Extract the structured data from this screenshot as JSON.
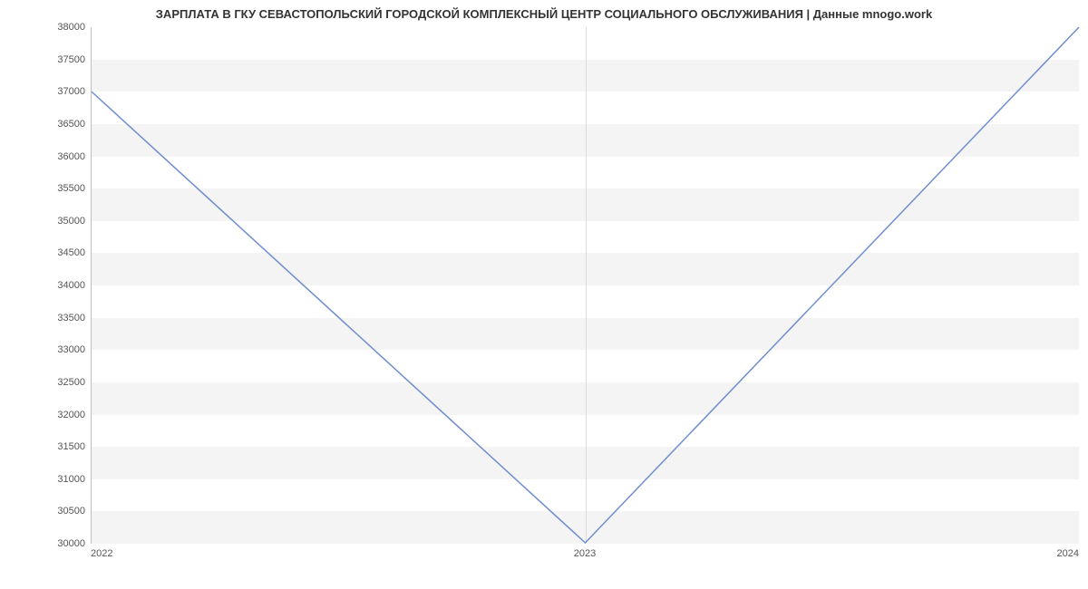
{
  "chart_data": {
    "type": "line",
    "title": "ЗАРПЛАТА В ГКУ СЕВАСТОПОЛЬСКИЙ ГОРОДСКОЙ КОМПЛЕКСНЫЙ ЦЕНТР СОЦИАЛЬНОГО ОБСЛУЖИВАНИЯ | Данные mnogo.work",
    "x": [
      2022,
      2023,
      2024
    ],
    "values": [
      37000,
      30000,
      38000
    ],
    "x_ticks": [
      "2022",
      "2023",
      "2024"
    ],
    "y_ticks": [
      30000,
      30500,
      31000,
      31500,
      32000,
      32500,
      33000,
      33500,
      34000,
      34500,
      35000,
      35500,
      36000,
      36500,
      37000,
      37500,
      38000
    ],
    "xlim": [
      2022,
      2024
    ],
    "ylim": [
      30000,
      38000
    ],
    "xlabel": "",
    "ylabel": "",
    "grid": true,
    "line_color": "#6f8ecf"
  }
}
